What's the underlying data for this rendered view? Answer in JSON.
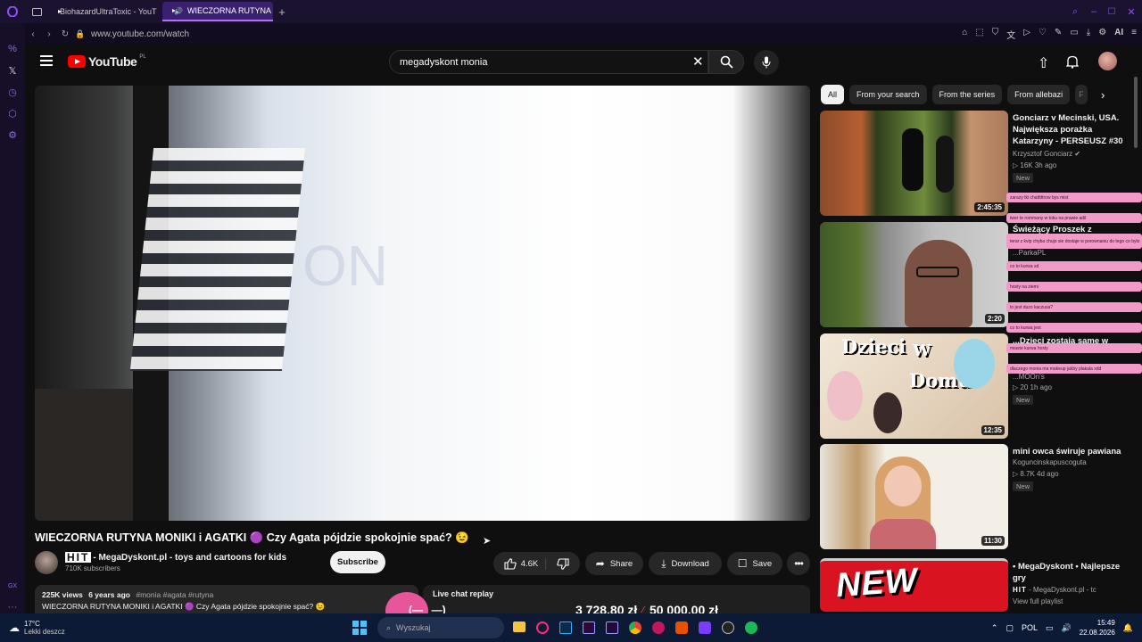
{
  "browser": {
    "tabs": [
      {
        "label": "BiohazardUltraToxic - YouT",
        "active": false
      },
      {
        "label": "WIECZORNA RUTYNA M",
        "active": true
      }
    ],
    "url": "www.youtube.com/watch",
    "ai_label": "AI"
  },
  "youtube": {
    "logo_text": "YouTube",
    "region": "PL",
    "search_value": "megadyskont monia"
  },
  "video": {
    "title": "WIECZORNA RUTYNA MONIKI i AGATKI 🟣 Czy Agata pójdzie spokojnie spać? 😉",
    "overlay_text": "ON"
  },
  "channel": {
    "logo_text": "HIT",
    "name": "- MegaDyskont.pl - toys and cartoons for kids",
    "subscribers": "710K subscribers",
    "subscribe_label": "Subscribe"
  },
  "actions": {
    "likes": "4.6K",
    "share": "Share",
    "download": "Download",
    "save": "Save"
  },
  "description": {
    "views": "225K views",
    "age": "6 years ago",
    "hashtags": "#monia #agata #rutyna",
    "text": "WIECZORNA RUTYNA MONIKI i AGATKI 🟣 Czy Agata pójdzie spokojnie spać? 😉"
  },
  "chat_replay": {
    "label": "Live chat replay",
    "face": "(—‿—)",
    "amount": "3 728,80 zł",
    "goal": "50 000,00 zł"
  },
  "chips": [
    "All",
    "From your search",
    "From the series",
    "From allebazi",
    "F"
  ],
  "recommendations": [
    {
      "title": "Gonciarz v Mecinski, USA. Największa porażka Katarzyny - PERSEUSZ #30",
      "channel": "Krzysztof Gonciarz",
      "meta": "▷ 16K  3h ago",
      "badge": "New",
      "duration": "2:45:35"
    },
    {
      "title": "Świeżący Proszek z",
      "channel": "...ParkaPL",
      "meta": "",
      "badge": "",
      "duration": "2:20"
    },
    {
      "title": "...Dzieci zostają same w",
      "channel": "...MOOn's",
      "meta": "▷ 20  1h ago",
      "badge": "New",
      "duration": "12:35",
      "thumb_text_1": "Dzieci",
      "thumb_text_2": "W",
      "thumb_text_3": "Domu"
    },
    {
      "title": "mini owca świruje pawiana",
      "channel": "Koguncinskapuscoguta",
      "meta": "▷ 8.7K  4d ago",
      "badge": "New",
      "duration": "11:30"
    },
    {
      "title": "• MegaDyskont • Najlepsze gry",
      "channel": "- MegaDyskont.pl - tc",
      "meta": "View full playlist",
      "badge": "",
      "duration": "",
      "thumb_text_1": "NEW"
    }
  ],
  "chat_overlay": [
    "zarazy tki chatttttrow bys mist",
    "twer te rommany w toku na prawie adil",
    "terar z kvip chyba chujo sie dostaje w porownaniu do tego co bylo",
    "co to kurwa xd",
    "hosty na ziemi",
    "to jest duzo kaczusa?",
    "co to kurwa jest",
    "miaste kurwa hosty",
    "dlaczego monia ma makeup jakby plakala xdd"
  ],
  "taskbar": {
    "temperature": "17°C",
    "weather": "Lekki deszcz",
    "search_placeholder": "Wyszukaj",
    "language": "POL",
    "time": "15:49",
    "date": "22.08.2026"
  },
  "colors": {
    "accent_purple": "#8a4dff",
    "youtube_red": "#ff0000",
    "chat_pink": "#f29bc8",
    "taskbar": "#0d1a36"
  }
}
